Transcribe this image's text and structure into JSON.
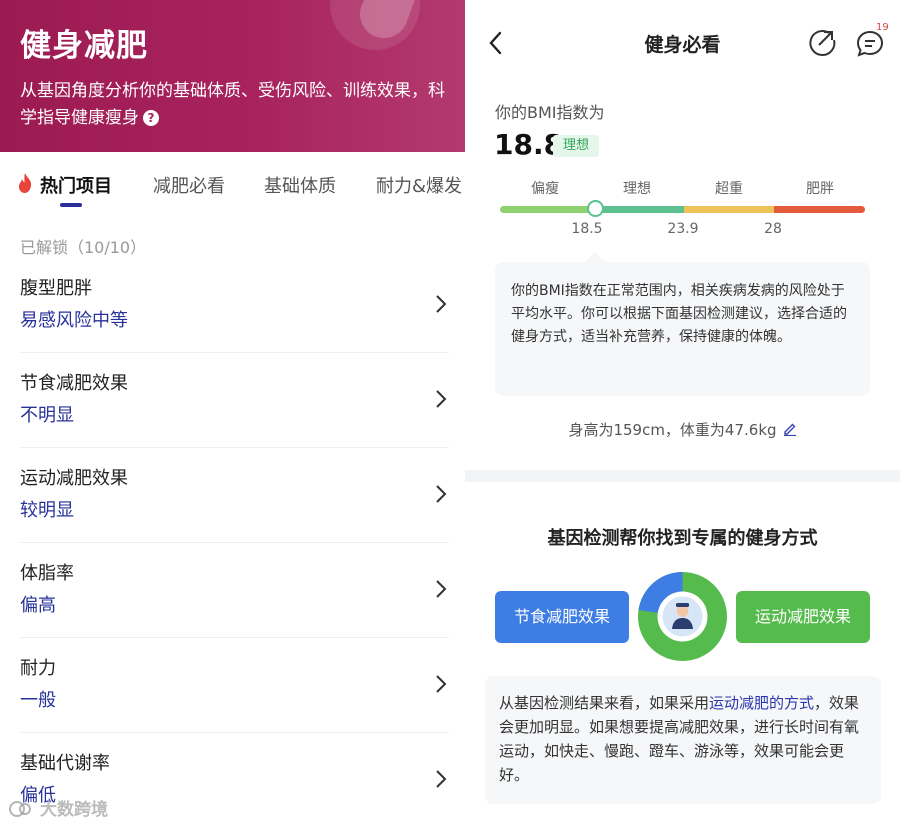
{
  "left": {
    "title": "健身减肥",
    "description": "从基因角度分析你的基础体质、受伤风险、训练效果，科学指导健康瘦身",
    "tabs": [
      "热门项目",
      "减肥必看",
      "基础体质",
      "耐力&爆发"
    ],
    "active_tab_index": 0,
    "unlocked": "已解锁（10/10）",
    "items": [
      {
        "name": "腹型肥胖",
        "value": "易感风险中等"
      },
      {
        "name": "节食减肥效果",
        "value": "不明显"
      },
      {
        "name": "运动减肥效果",
        "value": "较明显"
      },
      {
        "name": "体脂率",
        "value": "偏高"
      },
      {
        "name": "耐力",
        "value": "一般"
      },
      {
        "name": "基础代谢率",
        "value": "偏低"
      }
    ],
    "watermark": "大数跨境",
    "accent_color": "#a8235e",
    "value_color": "#27319a"
  },
  "right": {
    "nav_title": "健身必看",
    "notification_count": "19",
    "bmi_label": "你的BMI指数为",
    "bmi_value": "18.8",
    "bmi_status": "理想",
    "zones": [
      "偏瘦",
      "理想",
      "超重",
      "肥胖"
    ],
    "zone_colors": [
      "#8fd070",
      "#5cc08f",
      "#edc256",
      "#e35a3c"
    ],
    "thresholds": [
      "18.5",
      "23.9",
      "28"
    ],
    "bmi_marker_value": 18.8,
    "bmi_note": "你的BMI指数在正常范围内，相关疾病发病的风险处于平均水平。你可以根据下面基因检测建议，选择合适的健身方式，适当补充营养，保持健康的体魄。",
    "height_weight": "身高为159cm，体重为47.6kg",
    "gene_section_title": "基因检测帮你找到专属的健身方式",
    "btn_diet": "节食减肥效果",
    "btn_sport": "运动减肥效果",
    "result_prefix": "从基因检测结果来看，如果采用",
    "result_highlight": "运动减肥的方式",
    "result_suffix": "，效果会更加明显。如果想要提高减肥效果，进行长时间有氧运动，如快走、慢跑、蹬车、游泳等，效果可能会更好。"
  }
}
